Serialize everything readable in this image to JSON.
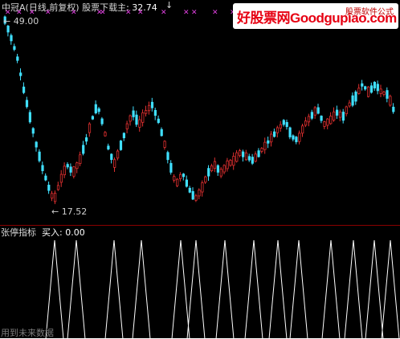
{
  "header": {
    "title": "中冠A(日线,前复权)",
    "stock_label": "股票下载主",
    "stock_value": ": 32.74",
    "cursor_glyph": "↓"
  },
  "watermark": {
    "site_text": "好股票网Goodgupiao.com",
    "tagline": "股票软件公式"
  },
  "markers": {
    "glyph": "✕",
    "color": "#e040e0",
    "count": 14
  },
  "price_labels": {
    "high": "49.00",
    "low": "17.52"
  },
  "indicator": {
    "name": "张停指标",
    "buy_label": "买入: 0.00",
    "future_note": "用到未来数据"
  },
  "colors": {
    "background": "#000000",
    "up_candle": "#e03030",
    "down_candle": "#40e0ff",
    "signal_line": "#ffffff",
    "divider": "#8a0000"
  }
}
